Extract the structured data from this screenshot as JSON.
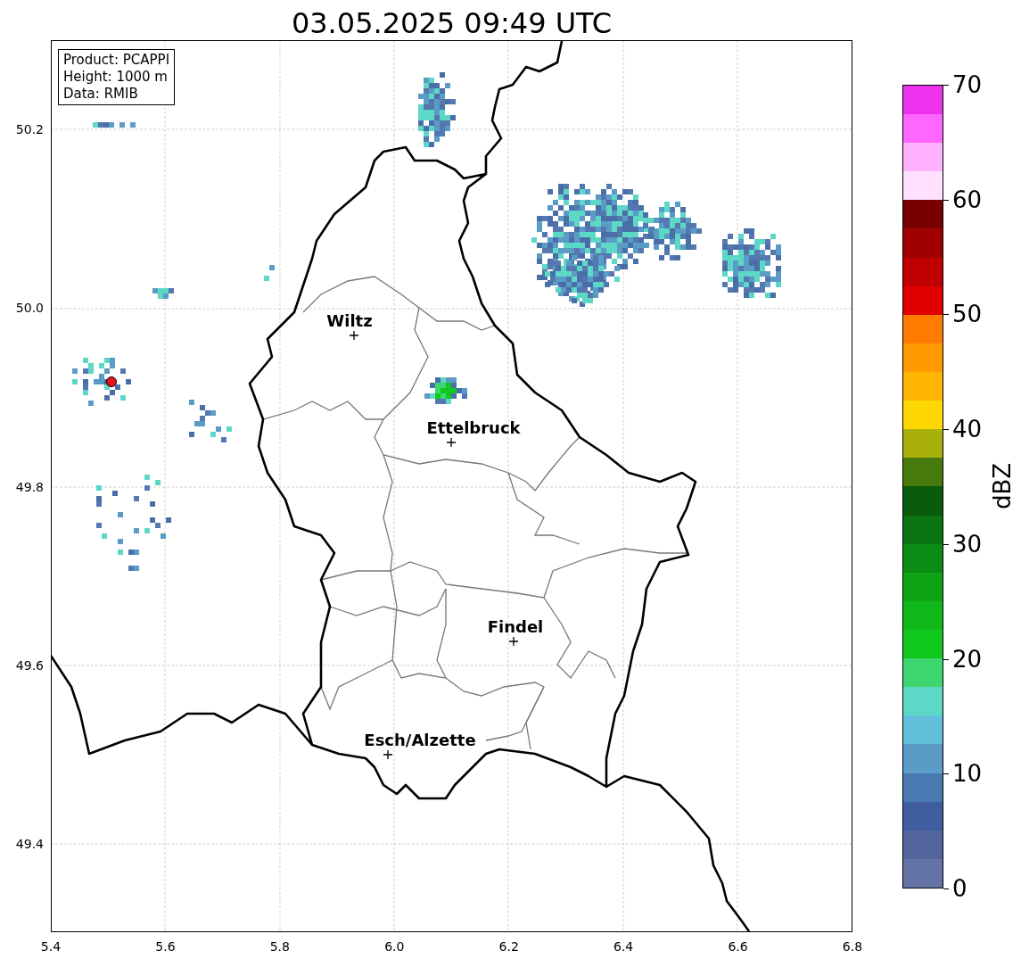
{
  "title": "03.05.2025 09:49 UTC",
  "info_box": [
    "Product: PCAPPI",
    "Height: 1000 m",
    "Data: RMIB"
  ],
  "cities": [
    "Wiltz",
    "Ettelbruck",
    "Findel",
    "Esch/Alzette"
  ],
  "xticks": [
    "5.4",
    "5.6",
    "5.8",
    "6.0",
    "6.2",
    "6.4",
    "6.6",
    "6.8"
  ],
  "yticks": [
    "50.2",
    "50.0",
    "49.8",
    "49.6",
    "49.4"
  ],
  "colorbar": {
    "label": "dBZ",
    "ticks": [
      "70",
      "60",
      "50",
      "40",
      "30",
      "20",
      "10",
      "0"
    ],
    "segments": [
      {
        "color": "#6474a6"
      },
      {
        "color": "#53669e"
      },
      {
        "color": "#405da0"
      },
      {
        "color": "#4a78b0"
      },
      {
        "color": "#5a9cc6"
      },
      {
        "color": "#63c0dc"
      },
      {
        "color": "#5ed8c6"
      },
      {
        "color": "#3ed670"
      },
      {
        "color": "#10c81e"
      },
      {
        "color": "#0fb818"
      },
      {
        "color": "#0ea416"
      },
      {
        "color": "#0c8c14"
      },
      {
        "color": "#0a7412"
      },
      {
        "color": "#085c0c"
      },
      {
        "color": "#467a0c"
      },
      {
        "color": "#aab00a"
      },
      {
        "color": "#ffd700"
      },
      {
        "color": "#ffb400"
      },
      {
        "color": "#ff9a00"
      },
      {
        "color": "#ff7c00"
      },
      {
        "color": "#e00000"
      },
      {
        "color": "#c00000"
      },
      {
        "color": "#a00000"
      },
      {
        "color": "#780000"
      },
      {
        "color": "#ffe0ff"
      },
      {
        "color": "#ffb0ff"
      },
      {
        "color": "#ff66ff"
      },
      {
        "color": "#ee33ee"
      }
    ]
  }
}
